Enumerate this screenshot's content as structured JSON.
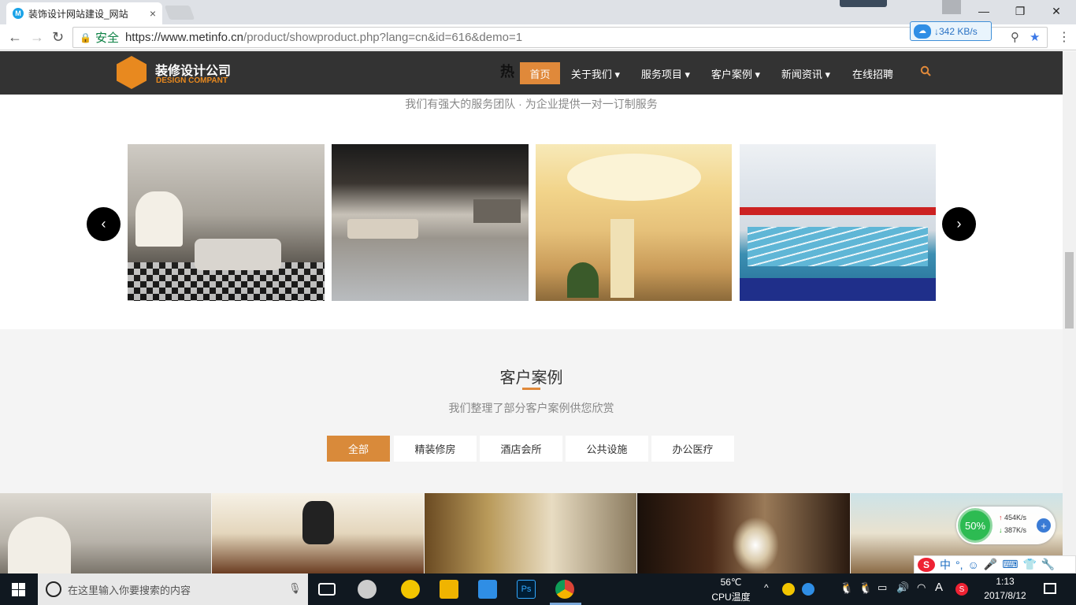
{
  "browser": {
    "tab_title": "装饰设计网站建设_网站",
    "tab_close": "×",
    "secure_label": "安全",
    "url_host": "https://www.metinfo.cn",
    "url_path": "/product/showproduct.php?lang=cn&id=616&demo=1",
    "baidu_speed": "↓342 KB/s",
    "nav_back": "←",
    "nav_forward": "→",
    "nav_reload": "↻",
    "win_min": "—",
    "win_max": "❐",
    "win_close": "✕",
    "star": "★",
    "zoom": "⚲"
  },
  "site": {
    "logo_cn": "装修设计公司",
    "logo_en": "DESIGN COMPANT",
    "hot_heading_fragment": "热",
    "menu": [
      {
        "label": "首页"
      },
      {
        "label": "关于我们 ▾"
      },
      {
        "label": "服务项目 ▾"
      },
      {
        "label": "客户案例 ▾"
      },
      {
        "label": "新闻资讯 ▾"
      },
      {
        "label": "在线招聘"
      }
    ],
    "hot_subtitle": "我们有强大的服务团队 · 为企业提供一对一订制服务",
    "carousel_prev": "‹",
    "carousel_next": "›",
    "cases_title": "客户案例",
    "cases_subtitle": "我们整理了部分客户案例供您欣赏",
    "filters": [
      {
        "label": "全部"
      },
      {
        "label": "精装修房"
      },
      {
        "label": "酒店会所"
      },
      {
        "label": "公共设施"
      },
      {
        "label": "办公医疗"
      }
    ]
  },
  "taskbar": {
    "search_placeholder": "在这里输入你要搜索的内容",
    "cpu_temp": "56℃",
    "cpu_label": "CPU温度",
    "time": "1:13",
    "date": "2017/8/12",
    "ime_lang": "中",
    "ime_a": "A"
  },
  "netwidget": {
    "percent": "50%",
    "up": "454K/s",
    "down": "387K/s"
  },
  "colors": {
    "accent": "#e0893a",
    "nav_bg": "#333333",
    "taskbar": "#101820"
  }
}
